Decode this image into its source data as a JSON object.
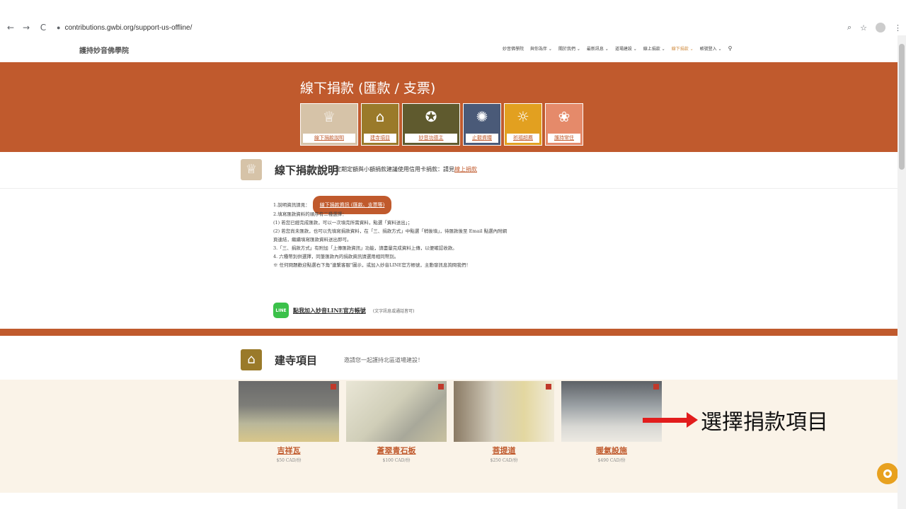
{
  "browser": {
    "url": "contributions.gwbi.org/support-us-offline/",
    "back_icon": "←",
    "forward_icon": "→",
    "reload_icon": "C",
    "lock_icon": "🔒",
    "zoom_icon": "⌕",
    "star_icon": "☆",
    "menu_icon": "⋮"
  },
  "site": {
    "logo": "護持妙音佛學院",
    "nav": [
      {
        "label": "妙音佛學院"
      },
      {
        "label": "與你為伴 ⌄"
      },
      {
        "label": "關於我們 ⌄"
      },
      {
        "label": "最新訊息 ⌄"
      },
      {
        "label": "道場建設 ⌄"
      },
      {
        "label": "線上捐款 ⌄"
      },
      {
        "label": "線下捐款 ⌄"
      },
      {
        "label": "帳號登入 ⌄"
      }
    ],
    "search_icon": "🔍"
  },
  "hero": {
    "title": "線下捐款 (匯款 / 支票)",
    "tiles": [
      {
        "label": "線下捐款說明",
        "glyph": "♕"
      },
      {
        "label": "建寺項目",
        "glyph": "⌂"
      },
      {
        "label": "妙音功德主",
        "glyph": "✪"
      },
      {
        "label": "止觀資糧",
        "glyph": "✺"
      },
      {
        "label": "祈福超薦",
        "glyph": "☼"
      },
      {
        "label": "護持常住",
        "glyph": "❀"
      }
    ]
  },
  "section1": {
    "title": "線下捐款說明",
    "subtitle": "定期定額與小額捐款建議使用信用卡捐款：請見",
    "subtitle_link": "線上捐款",
    "info_prefix": "1.說明資訊請見：",
    "info_button": "線下捐款資訊 (匯款、支票等)",
    "lines": [
      "2.填寫匯款資料的順序有二種選擇：",
      "(1) 若您已經完成匯款，可以一次填完所需資料，點選「資料送出」；",
      "(2) 若您尚未匯款，也可以先填寫捐款資料，在「三、捐款方式」中點選「稍後填」，待匯款後至 Email 點選內附網",
      "頁連結，繼續填寫匯款資料送出即可。",
      "3.「三、捐款方式」有附加「上傳匯款資訊」功能，請盡量完成資料上傳，以便確認收款。",
      "4. 六種幣別供選擇，同筆匯款內的捐款資訊請選用相同幣別。",
      "※ 任何問題歡迎點選右下角\"連繫客服\"圖示，或加入妙音LINE官方帳號，主動發訊息詢問我們！"
    ],
    "line_icon": "LINE",
    "line_link": "點我加入妙音LINE官方帳號",
    "line_note": "(文字訊息或通話皆可)"
  },
  "section2": {
    "title": "建寺項目",
    "subtitle": "邀請您一起護持北區道場建設！",
    "projects": [
      {
        "name": "吉祥瓦",
        "price": "$50 CAD/份"
      },
      {
        "name": "蒼翠青石板",
        "price": "$100 CAD/份"
      },
      {
        "name": "菩提道",
        "price": "$250 CAD/份"
      },
      {
        "name": "暖氣設施",
        "price": "$490 CAD/份"
      }
    ]
  },
  "annotation": {
    "text": "選擇捐款項目"
  },
  "colors": {
    "brand": "#c05a2d",
    "annotation_arrow": "#e21d1d"
  }
}
